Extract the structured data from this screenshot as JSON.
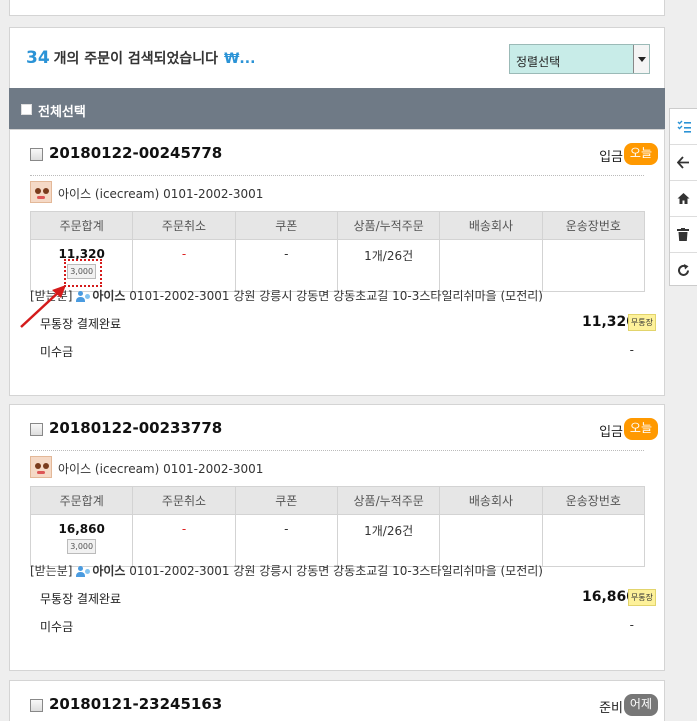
{
  "search_summary": {
    "count": "34",
    "text": "개의 주문이 검색되었습니다",
    "won": "₩..."
  },
  "sort": {
    "label": "정렬선택"
  },
  "select_all": {
    "label": "전체선택"
  },
  "columns": [
    "주문합계",
    "주문취소",
    "쿠폰",
    "상품/누적주문",
    "배송회사",
    "운송장번호"
  ],
  "orders": [
    {
      "number": "20180122-00245778",
      "status": "입금",
      "badge": "오늘",
      "buyer": "아이스 (icecream) 0101-2002-3001",
      "total": "11,320",
      "shipping_fee": "3,000",
      "cancel": "-",
      "coupon": "-",
      "products": "1개/26건",
      "courier": "",
      "tracking": "",
      "recipient_label": "[받는분]",
      "recipient_name": "아이스",
      "recipient_info": "0101-2002-3001 강원 강릉시 강동면 강동초교길 10-3스타일리쉬마을 (모전리)",
      "payment_label": "무통장 결제완료",
      "payment_amount": "11,320",
      "payment_method": "무통장",
      "unpaid_label": "미수금",
      "unpaid_value": "-"
    },
    {
      "number": "20180122-00233778",
      "status": "입금",
      "badge": "오늘",
      "buyer": "아이스 (icecream) 0101-2002-3001",
      "total": "16,860",
      "shipping_fee": "3,000",
      "cancel": "-",
      "coupon": "-",
      "products": "1개/26건",
      "courier": "",
      "tracking": "",
      "recipient_label": "[받는분]",
      "recipient_name": "아이스",
      "recipient_info": "0101-2002-3001 강원 강릉시 강동면 강동초교길 10-3스타일리쉬마을 (모전리)",
      "payment_label": "무통장 결제완료",
      "payment_amount": "16,860",
      "payment_method": "무통장",
      "unpaid_label": "미수금",
      "unpaid_value": "-"
    },
    {
      "number": "20180121-23245163",
      "status": "준비",
      "badge": "어제"
    }
  ],
  "sidebar_icons": [
    "list-check-icon",
    "arrow-left-icon",
    "home-icon",
    "trash-icon",
    "refresh-icon"
  ],
  "colors": {
    "accent": "#2b93d6",
    "today_badge": "#ff9900",
    "yesterday_badge": "#777777",
    "header_bar": "#6f7a86",
    "annotation": "#d41b1b"
  }
}
